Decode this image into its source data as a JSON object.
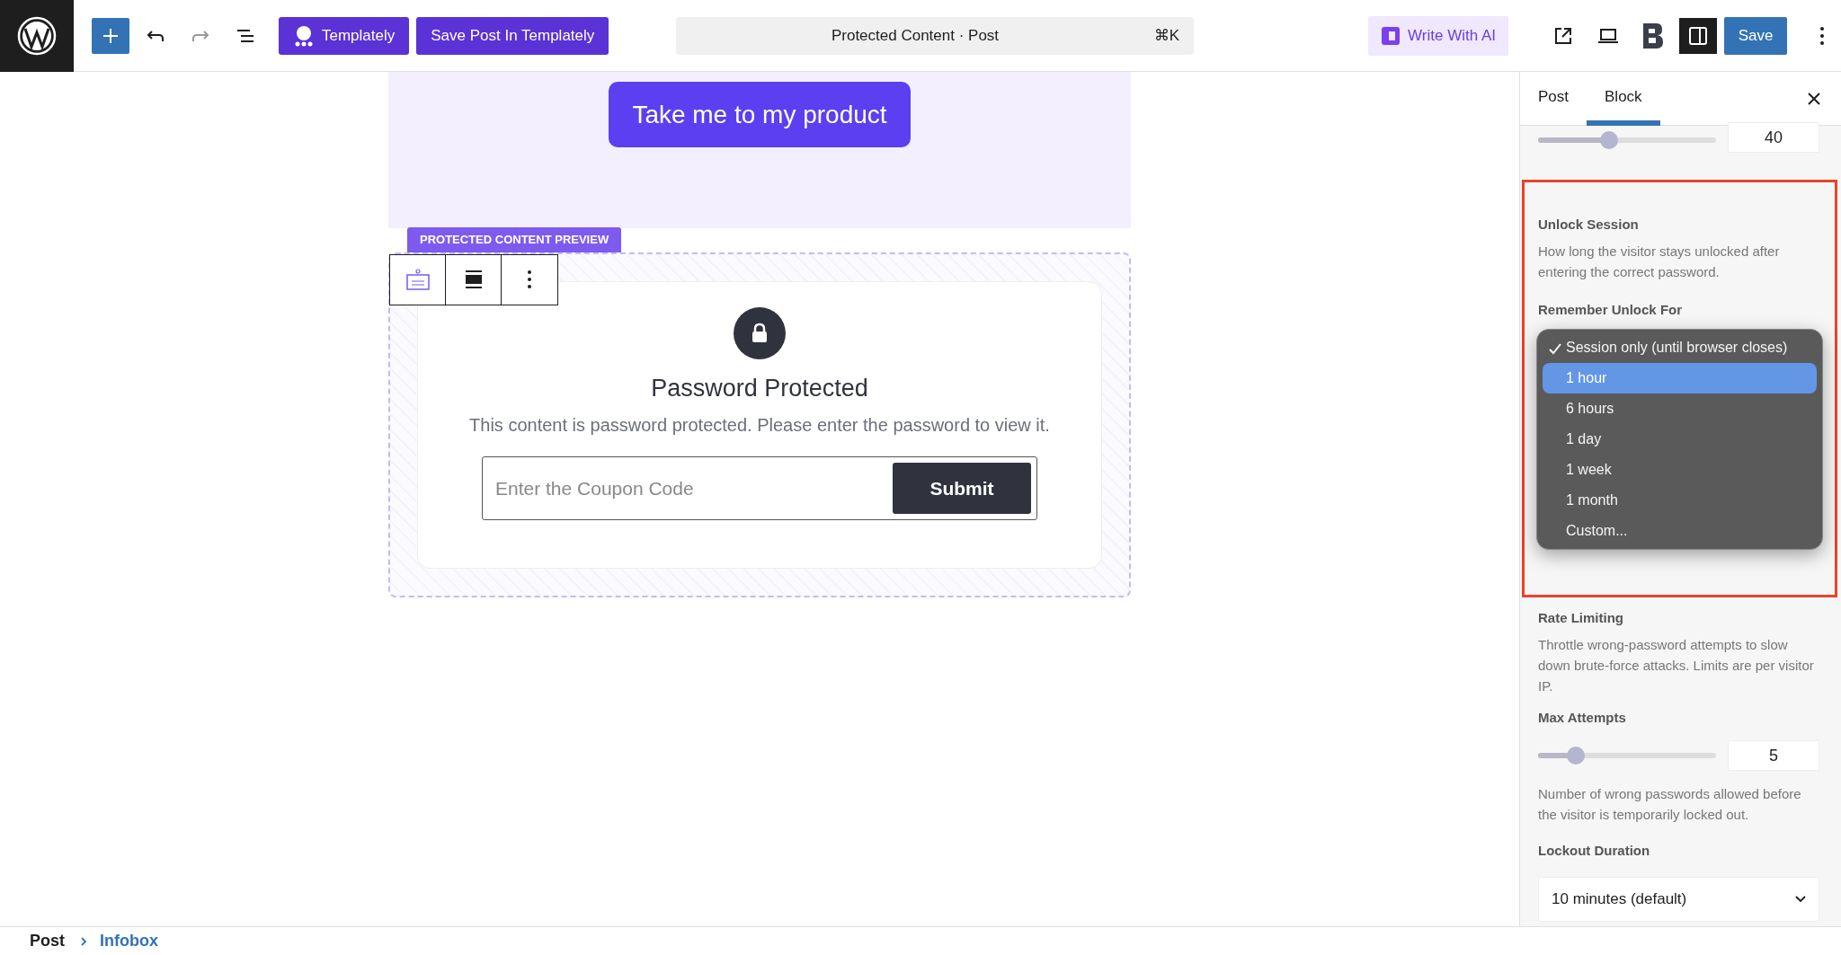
{
  "toolbar": {
    "templately_button": "Templately",
    "save_templately_button": "Save Post In Templately",
    "command_bar": {
      "title": "Protected Content · Post",
      "shortcut": "⌘K"
    },
    "ai_button": "Write With AI",
    "sidebar_toggle": {
      "on": true
    },
    "save_button": "Save"
  },
  "canvas": {
    "cta_button": "Take me to my product",
    "preview_label": "PROTECTED CONTENT PREVIEW",
    "card": {
      "title": "Password Protected",
      "message": "This content is password protected. Please enter the password to view it.",
      "input": {
        "placeholder": "Enter the Coupon Code"
      },
      "submit": "Submit"
    }
  },
  "sidebar": {
    "tabs": [
      {
        "label": "Post",
        "selected": false
      },
      {
        "label": "Block",
        "selected": true
      }
    ],
    "top_slider": {
      "level": 0.4,
      "value": "40"
    },
    "unlock_session": {
      "title": "Unlock Session",
      "description": "How long the visitor stays unlocked after entering the correct password.",
      "field_label": "Remember Unlock For",
      "options": [
        {
          "label": "Session only (until browser closes)",
          "checked": true,
          "selected": false
        },
        {
          "label": "1 hour",
          "checked": false,
          "selected": true
        },
        {
          "label": "6 hours",
          "checked": false,
          "selected": false
        },
        {
          "label": "1 day",
          "checked": false,
          "selected": false
        },
        {
          "label": "1 week",
          "checked": false,
          "selected": false
        },
        {
          "label": "1 month",
          "checked": false,
          "selected": false
        },
        {
          "label": "Custom...",
          "checked": false,
          "selected": false
        }
      ]
    },
    "rate_limiting": {
      "title": "Rate Limiting",
      "description": "Throttle wrong-password attempts to slow down brute-force attacks. Limits are per visitor IP.",
      "max_attempts": {
        "label": "Max Attempts",
        "level": 0.21,
        "value": "5",
        "help": "Number of wrong passwords allowed before the visitor is temporarily locked out."
      },
      "lockout_duration": {
        "label": "Lockout Duration",
        "value": "10 minutes (default)"
      }
    }
  },
  "breadcrumb": [
    {
      "label": "Post"
    },
    {
      "label": "Infobox"
    }
  ]
}
